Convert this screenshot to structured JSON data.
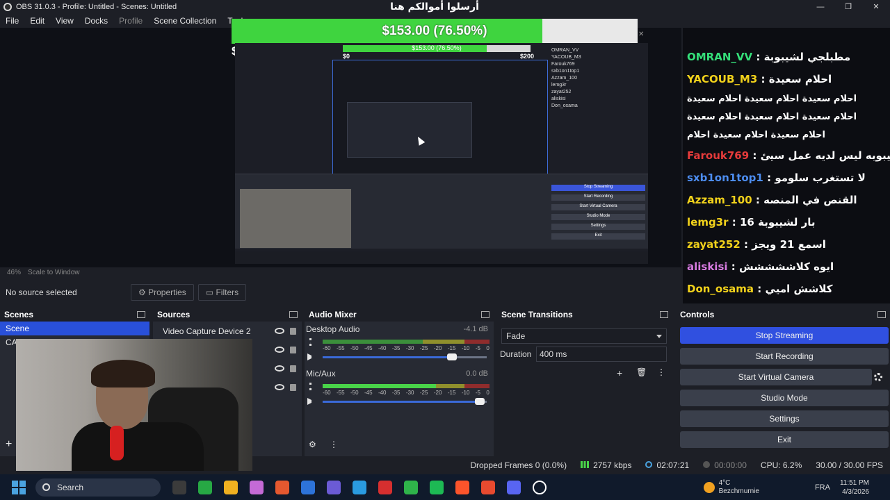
{
  "window": {
    "title": "OBS 31.0.3 - Profile: Untitled - Scenes: Untitled",
    "controls": [
      "—",
      "❐",
      "✕"
    ]
  },
  "menu": [
    "File",
    "Edit",
    "View",
    "Docks",
    "Profile",
    "Scene Collection",
    "Tools"
  ],
  "donation": {
    "title": "أرسلوا أموالكم هنا",
    "progress_fraction": 0.765,
    "amount_text": "$153.00 (76.50%)",
    "min_label": "$0",
    "max_label": "$200",
    "close_glyph": "✕"
  },
  "chat": [
    {
      "user": "OMRAN_VV",
      "color": "#35e07a",
      "message": ": مطبلجي لشيبوبة"
    },
    {
      "user": "YACOUB_M3",
      "color": "#f2d21b",
      "message": ": احلام سعيدة"
    },
    {
      "user": "",
      "color": "#ffffff",
      "message": "احلام سعيدة احلام سعيدة احلام سعيدة"
    },
    {
      "user": "",
      "color": "#ffffff",
      "message": "احلام سعيدة احلام سعيدة احلام سعيدة"
    },
    {
      "user": "",
      "color": "#ffffff",
      "message": "احلام سعيدة احلام سعيدة احلام"
    },
    {
      "user": "Farouk769",
      "color": "#e63b3b",
      "message": ": شيبوبه ليس لديه عمل سيئ"
    },
    {
      "user": "sxb1on1top1",
      "color": "#4d8df0",
      "message": ": لا تستغرب سلومو"
    },
    {
      "user": "Azzam_100",
      "color": "#f2d21b",
      "message": ": القنص في المنصه"
    },
    {
      "user": "lemg3r",
      "color": "#f2d21b",
      "message": ": بار لشيبوبة 16"
    },
    {
      "user": "zayat252",
      "color": "#f2d21b",
      "message": ": اسمع 21 ويجز"
    },
    {
      "user": "aliskisi",
      "color": "#d77be0",
      "message": ": ايوه كلاششششش"
    },
    {
      "user": "Don_osama",
      "color": "#f2d21b",
      "message": ": كلاشش اميي"
    }
  ],
  "preview": {
    "zoom": "46%",
    "scale_mode": "Scale to Window",
    "no_source": "No source selected",
    "properties_label": "Properties",
    "filters_label": "Filters"
  },
  "docks": {
    "scenes": {
      "title": "Scenes",
      "items": [
        "Scene",
        "CA"
      ],
      "selected": 0,
      "add_label": "+"
    },
    "sources": {
      "title": "Sources",
      "items": [
        "Video Capture Device 2"
      ]
    },
    "mixer": {
      "title": "Audio Mixer",
      "scale": [
        "-60",
        "-55",
        "-50",
        "-45",
        "-40",
        "-35",
        "-30",
        "-25",
        "-20",
        "-15",
        "-10",
        "-5",
        "0"
      ],
      "channels": [
        {
          "name": "Desktop Audio",
          "db": "-4.1 dB",
          "volume_fraction": 0.8,
          "level_fraction": 0.0
        },
        {
          "name": "Mic/Aux",
          "db": "0.0 dB",
          "volume_fraction": 0.97,
          "level_fraction": 0.68
        }
      ]
    },
    "transitions": {
      "title": "Scene Transitions",
      "transition": "Fade",
      "duration_label": "Duration",
      "duration": "400 ms"
    },
    "controls": {
      "title": "Controls",
      "buttons": [
        "Stop Streaming",
        "Start Recording",
        "Start Virtual Camera",
        "Studio Mode",
        "Settings",
        "Exit"
      ]
    }
  },
  "status": {
    "dropped": "Dropped Frames 0 (0.0%)",
    "bitrate": "2757 kbps",
    "stream_time": "02:07:21",
    "rec_time": "00:00:00",
    "cpu": "CPU: 6.2%",
    "fps": "30.00 / 30.00 FPS"
  },
  "taskbar": {
    "search": "Search",
    "weather_temp": "4°C",
    "weather_place": "Bezchmurnie",
    "lang": "FRA",
    "time": "11:51 PM",
    "date": "4/3/2026",
    "app_colors": [
      "#3b3b3b",
      "#27a844",
      "#f0b020",
      "#c46ad6",
      "#e5582f",
      "#2d73d9",
      "#6b5bd6",
      "#2a9be0",
      "#d62f2f",
      "#2fb34a",
      "#1db954",
      "#fb542b",
      "#e84a2f",
      "#5865f2",
      "#ffffff"
    ]
  }
}
